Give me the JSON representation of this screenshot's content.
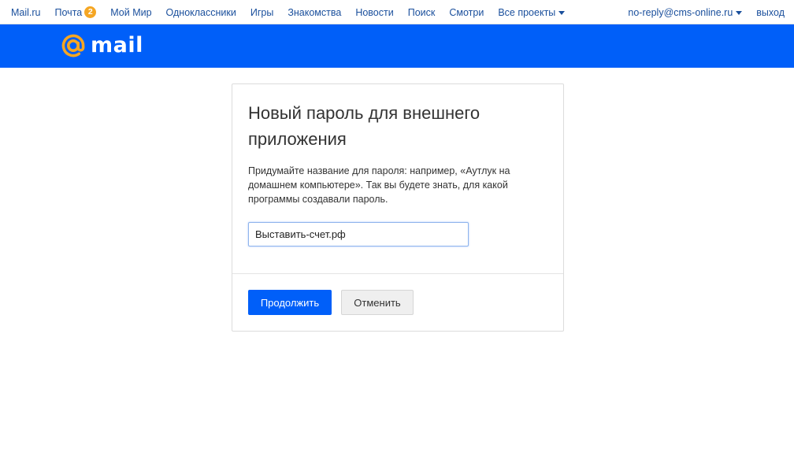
{
  "topnav": {
    "left_links": [
      {
        "label": "Mail.ru"
      },
      {
        "label": "Почта",
        "badge": "2"
      },
      {
        "label": "Мой Мир"
      },
      {
        "label": "Одноклассники"
      },
      {
        "label": "Игры"
      },
      {
        "label": "Знакомства"
      },
      {
        "label": "Новости"
      },
      {
        "label": "Поиск"
      },
      {
        "label": "Смотри"
      },
      {
        "label": "Все проекты"
      }
    ],
    "user_email": "no-reply@cms-online.ru",
    "logout_label": "выход"
  },
  "header": {
    "logo_text": "mail",
    "logo_icon": "at-sign-icon",
    "brand_color": "#005ff9",
    "logo_accent_color": "#f5a623"
  },
  "card": {
    "title": "Новый пароль для внешнего приложения",
    "description": "Придумайте название для пароля: например, «Аутлук на домашнем компьютере». Так вы будете знать, для какой программы создавали пароль.",
    "input_value": "Выставить-счет.рф",
    "continue_label": "Продолжить",
    "cancel_label": "Отменить"
  }
}
